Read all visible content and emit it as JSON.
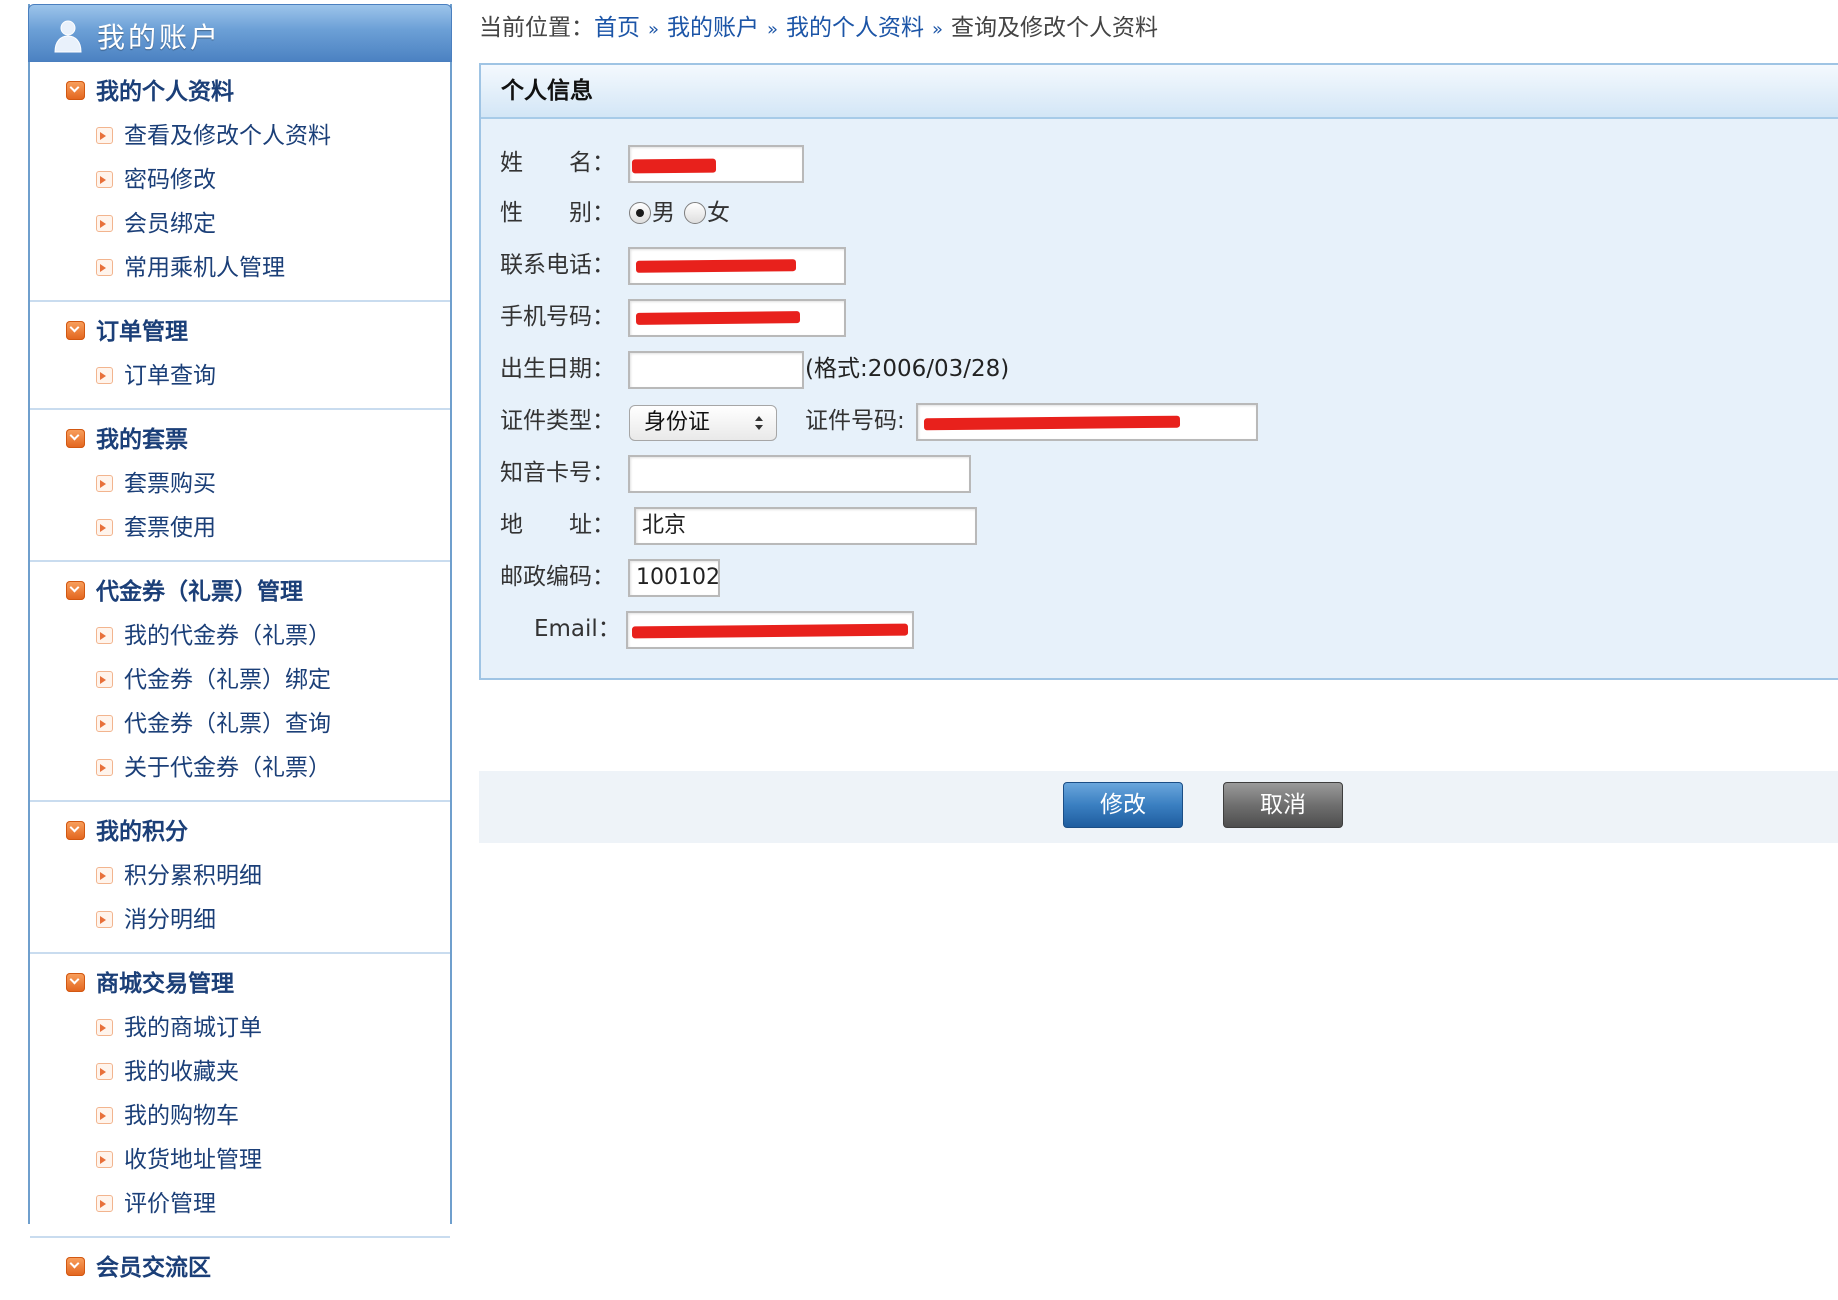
{
  "sidebar": {
    "title": "我的账户",
    "sections": [
      {
        "title": "我的个人资料",
        "items": [
          "查看及修改个人资料",
          "密码修改",
          "会员绑定",
          "常用乘机人管理"
        ]
      },
      {
        "title": "订单管理",
        "items": [
          "订单查询"
        ]
      },
      {
        "title": "我的套票",
        "items": [
          "套票购买",
          "套票使用"
        ]
      },
      {
        "title": "代金券（礼票）管理",
        "items": [
          "我的代金券（礼票）",
          "代金券（礼票）绑定",
          "代金券（礼票）查询",
          "关于代金券（礼票）"
        ]
      },
      {
        "title": "我的积分",
        "items": [
          "积分累积明细",
          "消分明细"
        ]
      },
      {
        "title": "商城交易管理",
        "items": [
          "我的商城订单",
          "我的收藏夹",
          "我的购物车",
          "收货地址管理",
          "评价管理"
        ]
      },
      {
        "title": "会员交流区",
        "items": []
      }
    ]
  },
  "breadcrumb": {
    "prefix": "当前位置：",
    "links": [
      "首页",
      "我的账户",
      "我的个人资料"
    ],
    "separator": "»",
    "current": "查询及修改个人资料"
  },
  "panel": {
    "title": "个人信息",
    "form": {
      "name_label": "姓　　名：",
      "gender_label": "性　　别：",
      "gender_options": [
        "男",
        "女"
      ],
      "gender_selected": "男",
      "phone_label": "联系电话：",
      "mobile_label": "手机号码：",
      "birth_label": "出生日期：",
      "birth_value": "",
      "birth_hint": "(格式:2006/03/28)",
      "idtype_label": "证件类型：",
      "idtype_value": "身份证",
      "idno_label": "证件号码:",
      "zhiyin_label": "知音卡号：",
      "zhiyin_value": "",
      "address_label": "地　　址：",
      "address_value": "北京",
      "postcode_label": "邮政编码：",
      "postcode_value": "100102",
      "email_label": "Email："
    }
  },
  "buttons": {
    "modify": "修改",
    "cancel": "取消"
  },
  "colors": {
    "sidebar_header": "#4c82c2",
    "link": "#1c55a7",
    "panel_bg": "#e7f1fa",
    "redaction": "#e8211c",
    "modify_button": "#2f74b8",
    "cancel_button": "#6a6a6a"
  },
  "icons": {
    "sidebar_header": "user-icon",
    "section": "checkbox-arrow-icon",
    "item": "arrow-right-icon",
    "select": "updown-icon"
  }
}
